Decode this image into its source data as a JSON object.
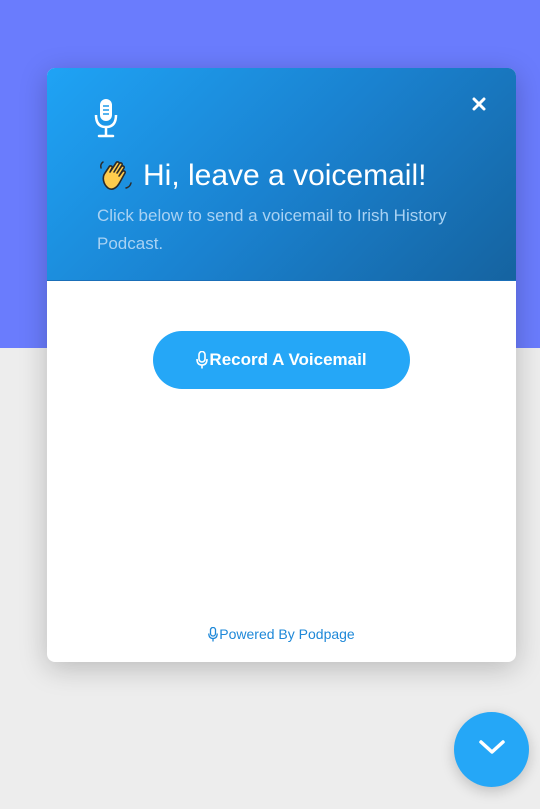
{
  "header": {
    "greeting": "Hi, leave a voicemail!",
    "subtitle": "Click below to send a voicemail to Irish History Podcast."
  },
  "actions": {
    "record_label": "Record A Voicemail"
  },
  "footer": {
    "powered_by": "Powered By Podpage"
  },
  "icons": {
    "header_mic": "microphone-icon",
    "close": "close-icon",
    "wave": "waving-hand-icon",
    "record_mic": "microphone-icon",
    "footer_mic": "microphone-icon",
    "toggle": "chevron-down-icon"
  },
  "colors": {
    "page_top": "#6a7cfd",
    "page_bottom": "#ededed",
    "header_gradient_start": "#1fa3f5",
    "header_gradient_end": "#1563a0",
    "accent": "#25a7f7",
    "link": "#1e88d8"
  }
}
